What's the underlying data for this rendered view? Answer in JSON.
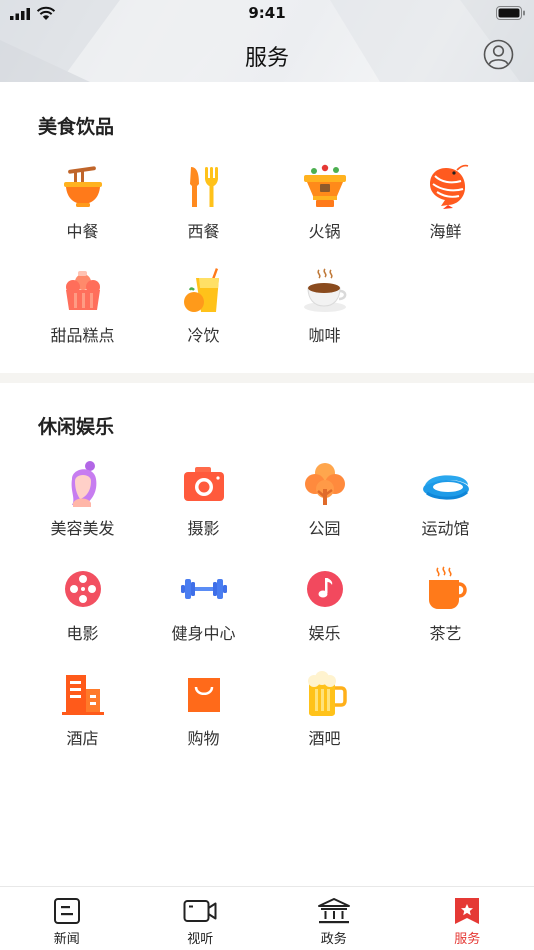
{
  "status_bar": {
    "time": "9:41"
  },
  "header": {
    "title": "服务"
  },
  "sections": [
    {
      "title": "美食饮品",
      "items": [
        {
          "label": "中餐",
          "icon": "noodle-bowl-icon"
        },
        {
          "label": "西餐",
          "icon": "fork-knife-icon"
        },
        {
          "label": "火锅",
          "icon": "hotpot-icon"
        },
        {
          "label": "海鲜",
          "icon": "shrimp-icon"
        },
        {
          "label": "甜品糕点",
          "icon": "cake-icon"
        },
        {
          "label": "冷饮",
          "icon": "cold-drink-icon"
        },
        {
          "label": "咖啡",
          "icon": "coffee-cup-icon"
        }
      ]
    },
    {
      "title": "休闲娱乐",
      "items": [
        {
          "label": "美容美发",
          "icon": "woman-hair-icon"
        },
        {
          "label": "摄影",
          "icon": "camera-icon"
        },
        {
          "label": "公园",
          "icon": "tree-icon"
        },
        {
          "label": "运动馆",
          "icon": "stadium-icon"
        },
        {
          "label": "电影",
          "icon": "film-reel-icon"
        },
        {
          "label": "健身中心",
          "icon": "dumbbell-icon"
        },
        {
          "label": "娱乐",
          "icon": "music-note-icon"
        },
        {
          "label": "茶艺",
          "icon": "tea-cup-icon"
        },
        {
          "label": "酒店",
          "icon": "hotel-building-icon"
        },
        {
          "label": "购物",
          "icon": "shopping-bag-icon"
        },
        {
          "label": "酒吧",
          "icon": "beer-mug-icon"
        }
      ]
    }
  ],
  "tabbar": {
    "tabs": [
      {
        "label": "新闻",
        "icon": "news-icon",
        "active": false
      },
      {
        "label": "视听",
        "icon": "video-camera-icon",
        "active": false
      },
      {
        "label": "政务",
        "icon": "government-building-icon",
        "active": false
      },
      {
        "label": "服务",
        "icon": "service-bookmark-star-icon",
        "active": true
      }
    ]
  },
  "colors": {
    "accent": "#e53935",
    "icon_orange": "#ff7a1a",
    "icon_yellow": "#ffc21a"
  }
}
